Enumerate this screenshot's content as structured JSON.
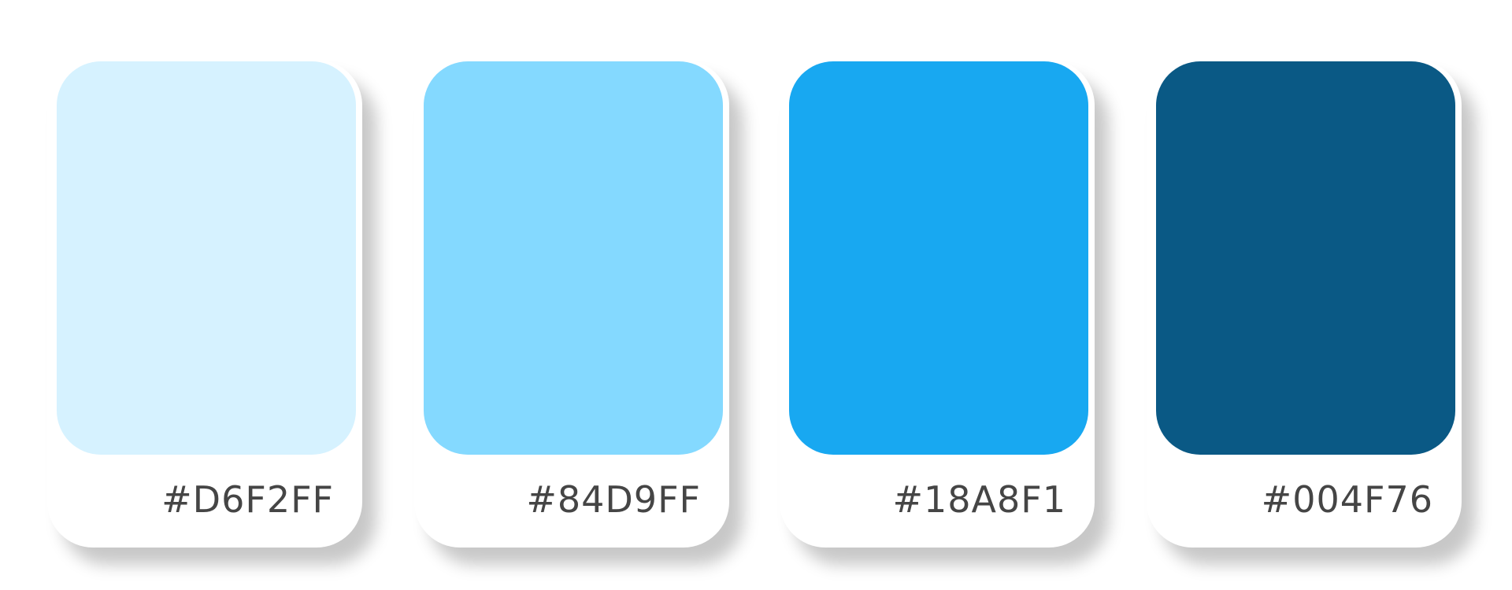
{
  "swatches": [
    {
      "hex": "#D6F2FF",
      "color": "#D6F2FF"
    },
    {
      "hex": "#84D9FF",
      "color": "#84D9FF"
    },
    {
      "hex": "#18A8F1",
      "color": "#18A8F1"
    },
    {
      "hex": "#004F76",
      "color": "#0A5985"
    }
  ]
}
